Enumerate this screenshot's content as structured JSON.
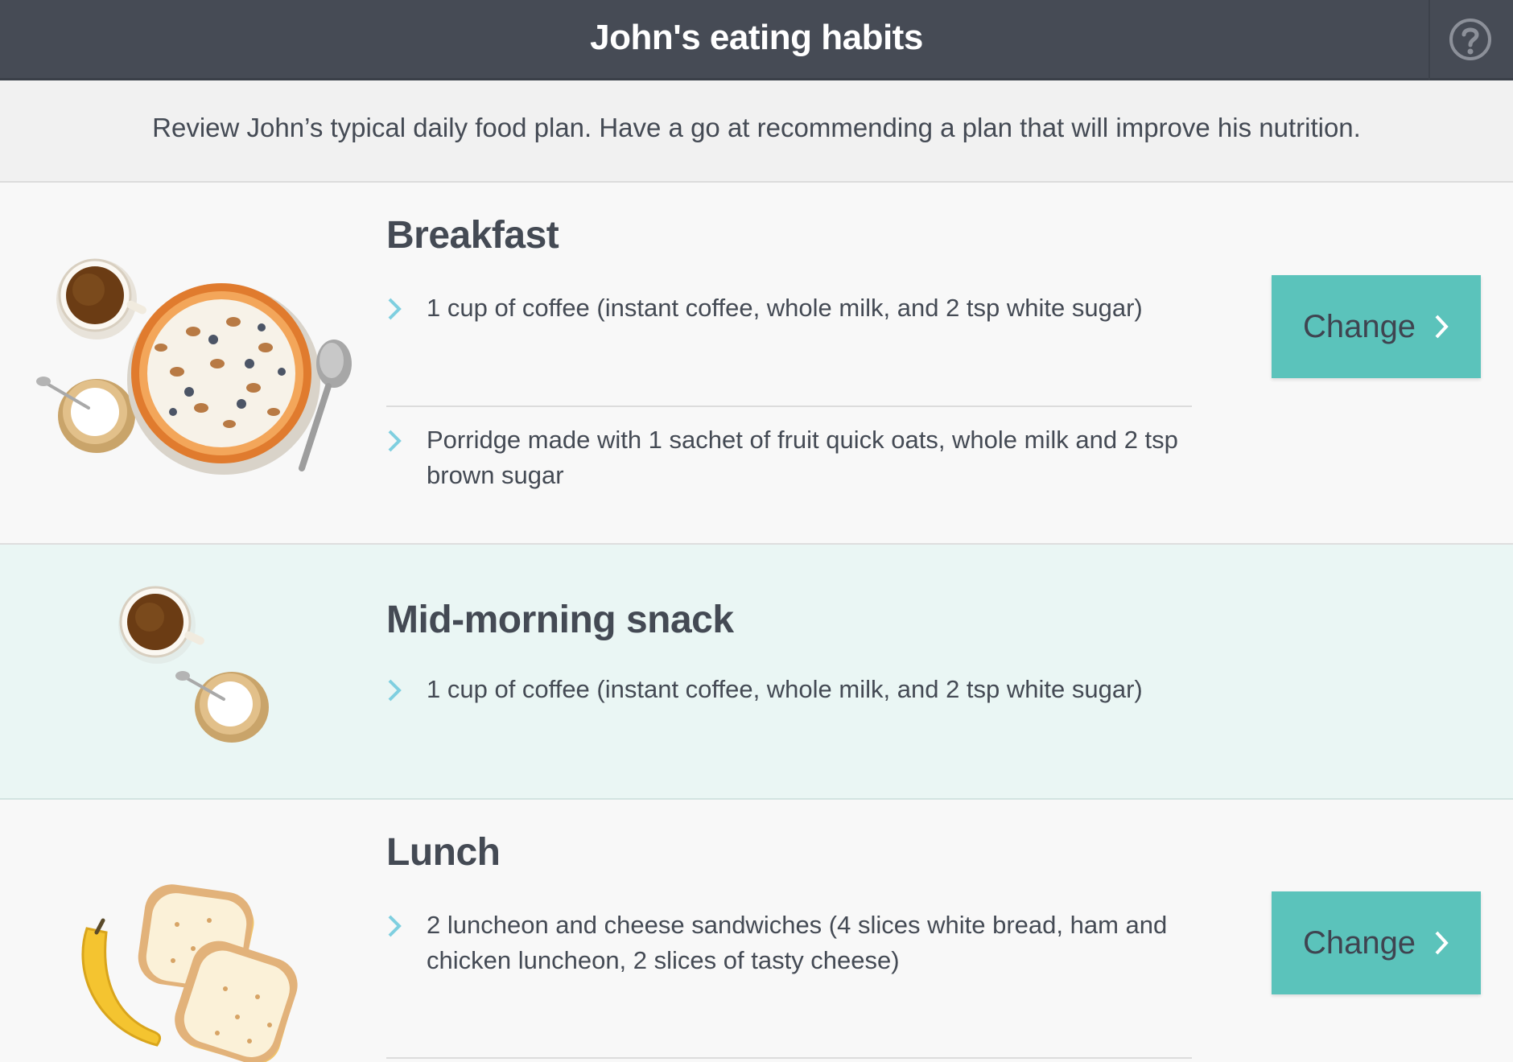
{
  "header": {
    "title": "John's eating habits",
    "help_icon": "help-circle-icon"
  },
  "intro": {
    "text": "Review John’s typical daily food plan. Have a go at recommending a plan that will improve his nutrition."
  },
  "meals": [
    {
      "title": "Breakfast",
      "items": [
        "1 cup of coffee (instant coffee, whole milk, and 2 tsp white sugar)",
        "Porridge made with 1 sachet of fruit quick oats, whole milk and 2 tsp brown sugar"
      ],
      "button_label": "Change",
      "illustration": "coffee-sugar-porridge-illustration"
    },
    {
      "title": "Mid-morning snack",
      "items": [
        "1 cup of coffee (instant coffee, whole milk, and 2 tsp white sugar)"
      ],
      "illustration": "coffee-sugar-illustration"
    },
    {
      "title": "Lunch",
      "items": [
        "2 luncheon and cheese sandwiches (4 slices white bread, ham and chicken luncheon, 2 slices of tasty cheese)"
      ],
      "button_label": "Change",
      "illustration": "banana-sandwiches-illustration"
    }
  ],
  "colors": {
    "header_bg": "#464b55",
    "accent": "#5bc3bb",
    "chevron": "#7fcfe0",
    "snack_bg": "#eaf6f4"
  }
}
